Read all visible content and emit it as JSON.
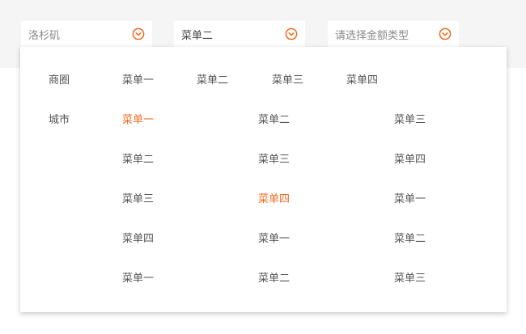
{
  "selects": [
    {
      "text": "洛杉矶",
      "kind": "placeholder",
      "icon": "chevron-down-circle-icon"
    },
    {
      "text": "菜单二",
      "kind": "value",
      "icon": "chevron-down-circle-icon"
    },
    {
      "text": "请选择金额类型",
      "kind": "placeholder",
      "icon": "chevron-down-circle-icon"
    }
  ],
  "accent_color": "#f26a21",
  "dropdown": {
    "shangquan_label": "商圈",
    "shangquan_items": [
      "菜单一",
      "菜单二",
      "菜单三",
      "菜单四"
    ],
    "city_label": "城市",
    "city_grid": [
      [
        "菜单一",
        "菜单二",
        "菜单三"
      ],
      [
        "菜单二",
        "菜单三",
        "菜单四"
      ],
      [
        "菜单三",
        "菜单四",
        "菜单一"
      ],
      [
        "菜单四",
        "菜单一",
        "菜单二"
      ],
      [
        "菜单一",
        "菜单二",
        "菜单三"
      ]
    ],
    "active_cells": [
      [
        0,
        0
      ],
      [
        2,
        1
      ]
    ]
  }
}
